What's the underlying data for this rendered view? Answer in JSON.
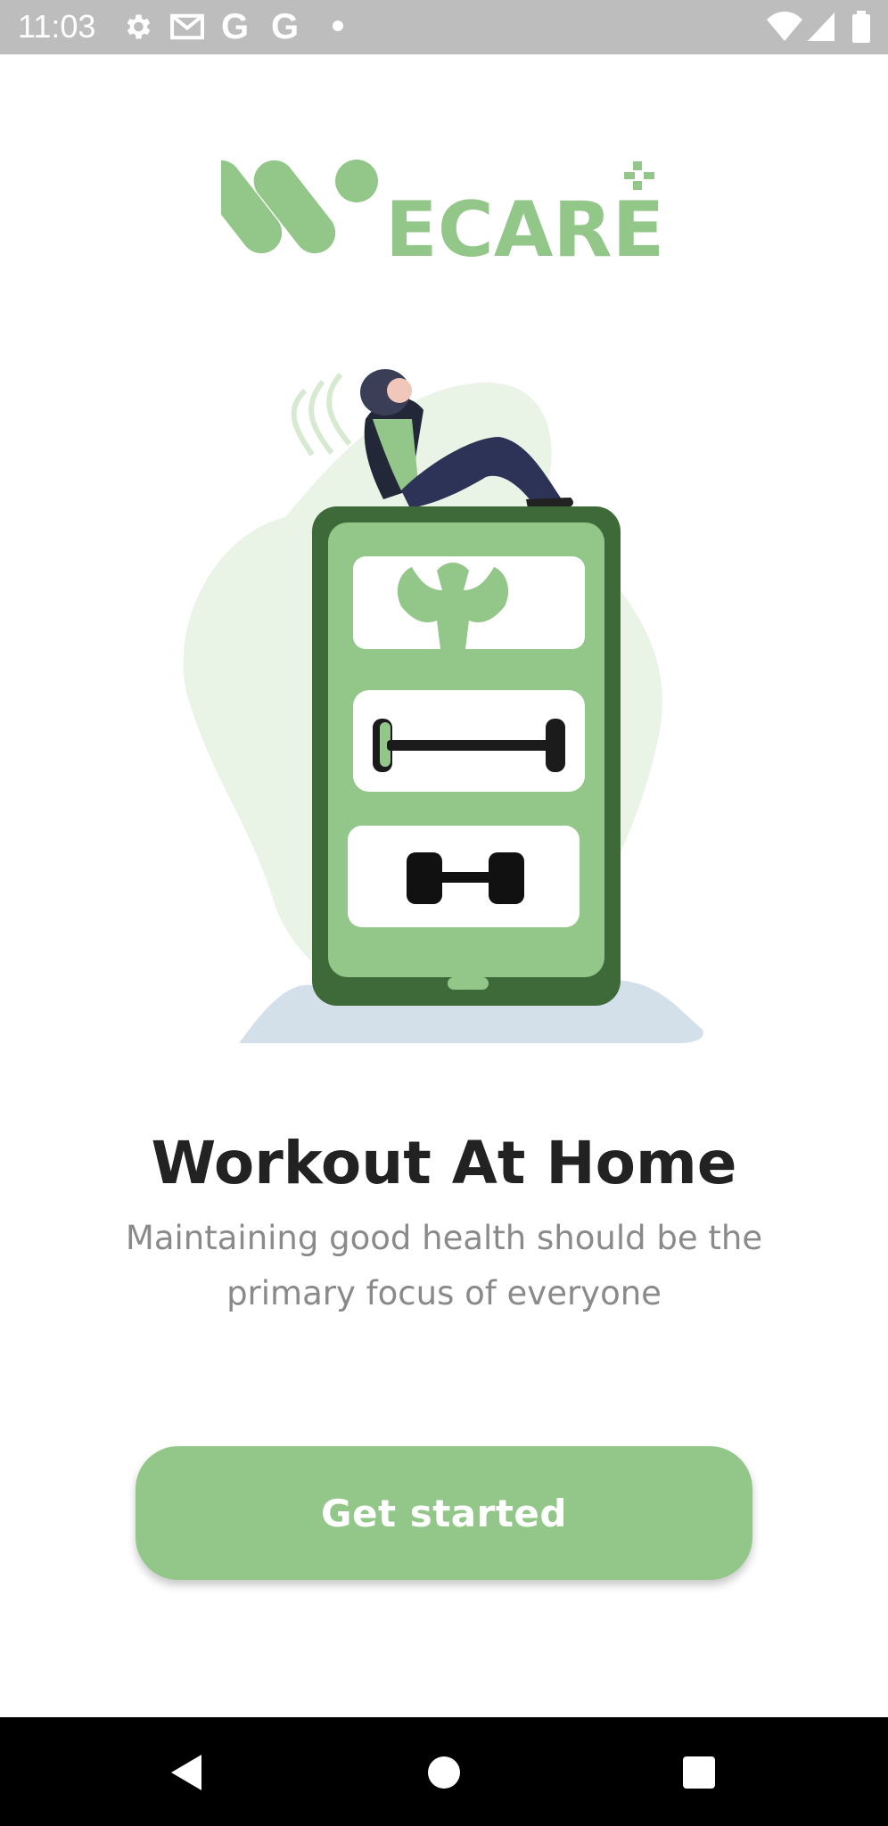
{
  "status_bar": {
    "time": "11:03",
    "icons": [
      "settings-icon",
      "gmail-icon",
      "google-icon",
      "google-icon",
      "notification-dot-icon",
      "wifi-icon",
      "signal-icon",
      "battery-icon"
    ],
    "google_glyph": "G"
  },
  "logo": {
    "text": "ECARE",
    "color": "#93c789"
  },
  "illustration": {
    "description_icon": "workout-phone-illustration"
  },
  "content": {
    "title": "Workout At Home",
    "subtitle": "Maintaining good health should be the primary focus of everyone"
  },
  "cta": {
    "label": "Get started",
    "color": "#93c789"
  },
  "nav_bar": {
    "buttons": [
      "back-icon",
      "home-icon",
      "recents-icon"
    ]
  },
  "colors": {
    "accent": "#93c789",
    "phone_dark": "#3e6a3a",
    "status_bar": "#bdbdbd",
    "title": "#222222",
    "subtitle": "#8a8a8a"
  }
}
